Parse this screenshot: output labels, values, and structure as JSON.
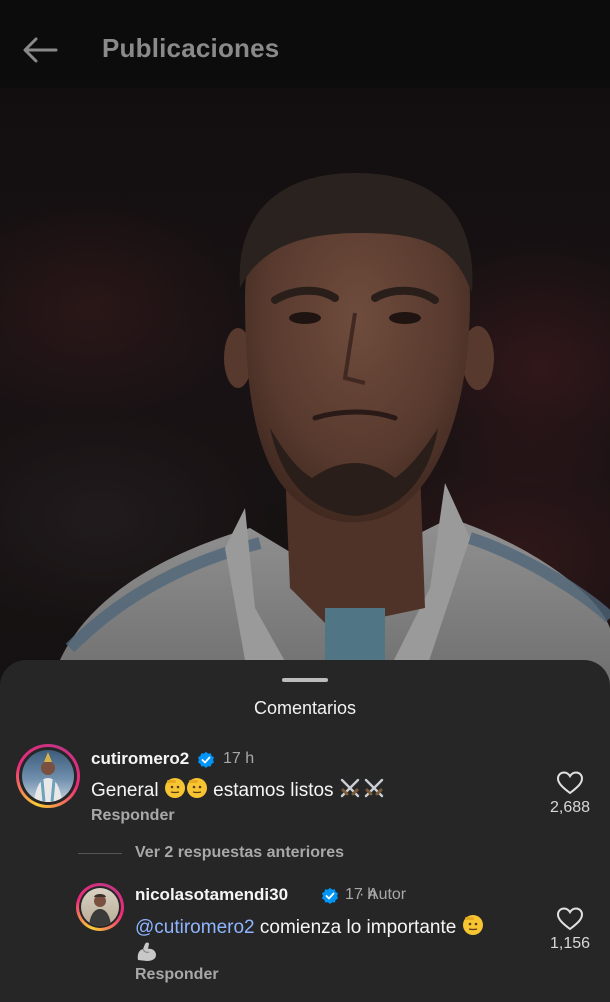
{
  "header": {
    "title": "Publicaciones"
  },
  "sheet": {
    "title": "Comentarios",
    "comments": [
      {
        "username": "cutiromero2",
        "time": "17 h",
        "text_before": "General",
        "text_after": "estamos listos",
        "reply_label": "Responder",
        "likes": "2,688"
      }
    ],
    "view_replies": "Ver 2 respuestas anteriores",
    "replies": [
      {
        "username": "nicolasotamendi30",
        "time": "17 h",
        "author_label": "· Autor",
        "mention": "@cutiromero2",
        "text": "comienza lo importante",
        "reply_label": "Responder",
        "likes": "1,156"
      }
    ]
  },
  "icons": {
    "back": "arrow-left-icon",
    "verified": "verified-badge-icon",
    "like": "heart-outline-icon",
    "emoji_salute": "saluting-face-emoji",
    "emoji_swords": "crossed-swords-emoji",
    "emoji_muscle": "flexed-biceps-emoji"
  },
  "colors": {
    "background": "#0c0c0c",
    "sheet": "#262626",
    "verified": "#0095f6",
    "mention": "#8fb5ff",
    "secondary_text": "#a8a8a8"
  }
}
